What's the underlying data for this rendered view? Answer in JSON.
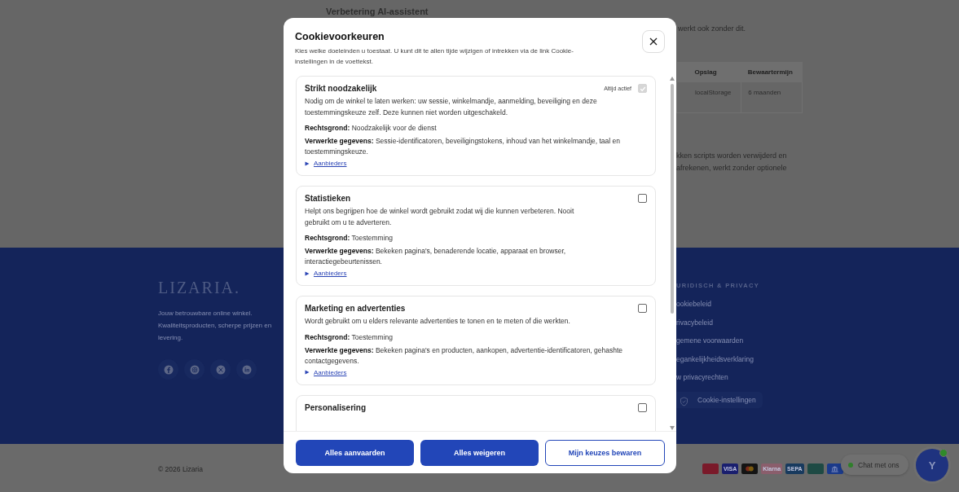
{
  "page": {
    "heading": "Verbetering AI-assistent",
    "text_fragment": "werkt ook zonder dit.",
    "table": {
      "columns": [
        "Opslag",
        "Bewaartermijn"
      ],
      "rows": [
        [
          "localStorage",
          "6 maanden"
        ]
      ]
    },
    "paragraph_lines": [
      "kken scripts worden verwijderd en",
      "afrekenen, werkt zonder optionele"
    ]
  },
  "footer": {
    "logo": "LIZARIA.",
    "tagline": "Jouw betrouwbare online winkel. Kwaliteitsproducten, scherpe prijzen en levering.",
    "socials": [
      {
        "kind": "facebook"
      },
      {
        "kind": "instagram"
      },
      {
        "kind": "x"
      },
      {
        "kind": "linkedin"
      }
    ],
    "legal_heading": "URIDISCH & PRIVACY",
    "legal_links": [
      "ookiebeleid",
      "rivacybeleid",
      "gemene voorwaarden",
      "egankelijkheidsverklaring",
      "w privacyrechten"
    ],
    "cookie_settings": "Cookie-instellingen"
  },
  "bottom_bar": {
    "copyright": "© 2026 Lizaria",
    "payments": [
      {
        "color": "#7a1a2a"
      },
      {
        "color": "#1a1f6e",
        "label": "VISA"
      },
      {
        "color": "#141414",
        "kind": "mastercard"
      },
      {
        "color": "#8a5e6c",
        "label": "Klarna"
      },
      {
        "color": "#183a5e",
        "label": "SEPA"
      },
      {
        "color": "#1e4a44"
      },
      {
        "color": "#1b3a8a",
        "kind": "bank"
      }
    ],
    "chat": {
      "label": "Chat met ons",
      "online": true
    },
    "avatar": {
      "initial": "Y",
      "online": true
    }
  },
  "modal": {
    "title": "Cookievoorkeuren",
    "description": "Kies welke doeleinden u toestaat. U kunt dit te allen tijde wijzigen of intrekken via de link Cookie-instellingen in de voettekst.",
    "categories": [
      {
        "title": "Strikt noodzakelijk",
        "badge": "Altijd actief",
        "checked": true,
        "disabled": true,
        "description": "Nodig om de winkel te laten werken: uw sessie, winkelmandje, aanmelding, beveiliging en deze toestemmingskeuze zelf. Deze kunnen niet worden uitgeschakeld.",
        "legal_basis_label": "Rechtsgrond:",
        "legal_basis": "Noodzakelijk voor de dienst",
        "data_label": "Verwerkte gegevens:",
        "data": "Sessie-identificatoren, beveiligingstokens, inhoud van het winkelmandje, taal en toestemmingskeuze.",
        "providers": "Aanbieders",
        "expanded": false
      },
      {
        "title": "Statistieken",
        "checked": false,
        "description": "Helpt ons begrijpen hoe de winkel wordt gebruikt zodat wij die kunnen verbeteren. Nooit gebruikt om u te adverteren.",
        "legal_basis_label": "Rechtsgrond:",
        "legal_basis": "Toestemming",
        "data_label": "Verwerkte gegevens:",
        "data": "Bekeken pagina's, benaderende locatie, apparaat en browser, interactiegebeurtenissen.",
        "providers": "Aanbieders",
        "expanded": false
      },
      {
        "title": "Marketing en advertenties",
        "checked": false,
        "description": "Wordt gebruikt om u elders relevante advertenties te tonen en te meten of die werkten.",
        "legal_basis_label": "Rechtsgrond:",
        "legal_basis": "Toestemming",
        "data_label": "Verwerkte gegevens:",
        "data": "Bekeken pagina's en producten, aankopen, advertentie-identificatoren, gehashte contactgegevens.",
        "providers": "Aanbieders",
        "expanded": false
      },
      {
        "title": "Personalisering",
        "checked": false
      }
    ],
    "buttons": [
      {
        "label": "Alles aanvaarden",
        "kind": "primary"
      },
      {
        "label": "Alles weigeren",
        "kind": "primary"
      },
      {
        "label": "Mijn keuzes bewaren",
        "kind": "outline"
      }
    ]
  }
}
